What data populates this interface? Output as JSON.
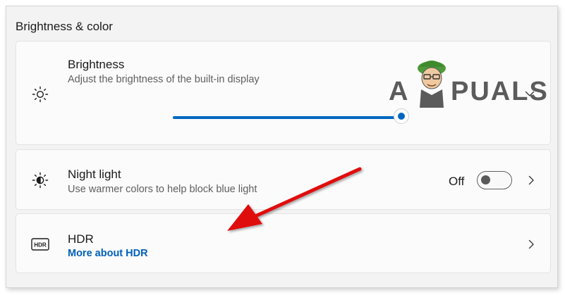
{
  "section": {
    "title": "Brightness & color"
  },
  "brightness": {
    "title": "Brightness",
    "subtitle": "Adjust the brightness of the built-in display",
    "level": 1.0,
    "icon": "sun-icon",
    "expand_icon": "chevron-down-icon"
  },
  "night_light": {
    "title": "Night light",
    "subtitle": "Use warmer colors to help block blue light",
    "state": "Off",
    "icon": "night-light-icon",
    "nav_icon": "chevron-right-icon"
  },
  "hdr": {
    "title": "HDR",
    "link": "More about HDR",
    "icon": "hdr-icon",
    "nav_icon": "chevron-right-icon"
  },
  "watermark": {
    "text": "A PUALS"
  },
  "colors": {
    "accent": "#0067c0",
    "link": "#005fb8",
    "annotation_arrow": "#e01010"
  }
}
